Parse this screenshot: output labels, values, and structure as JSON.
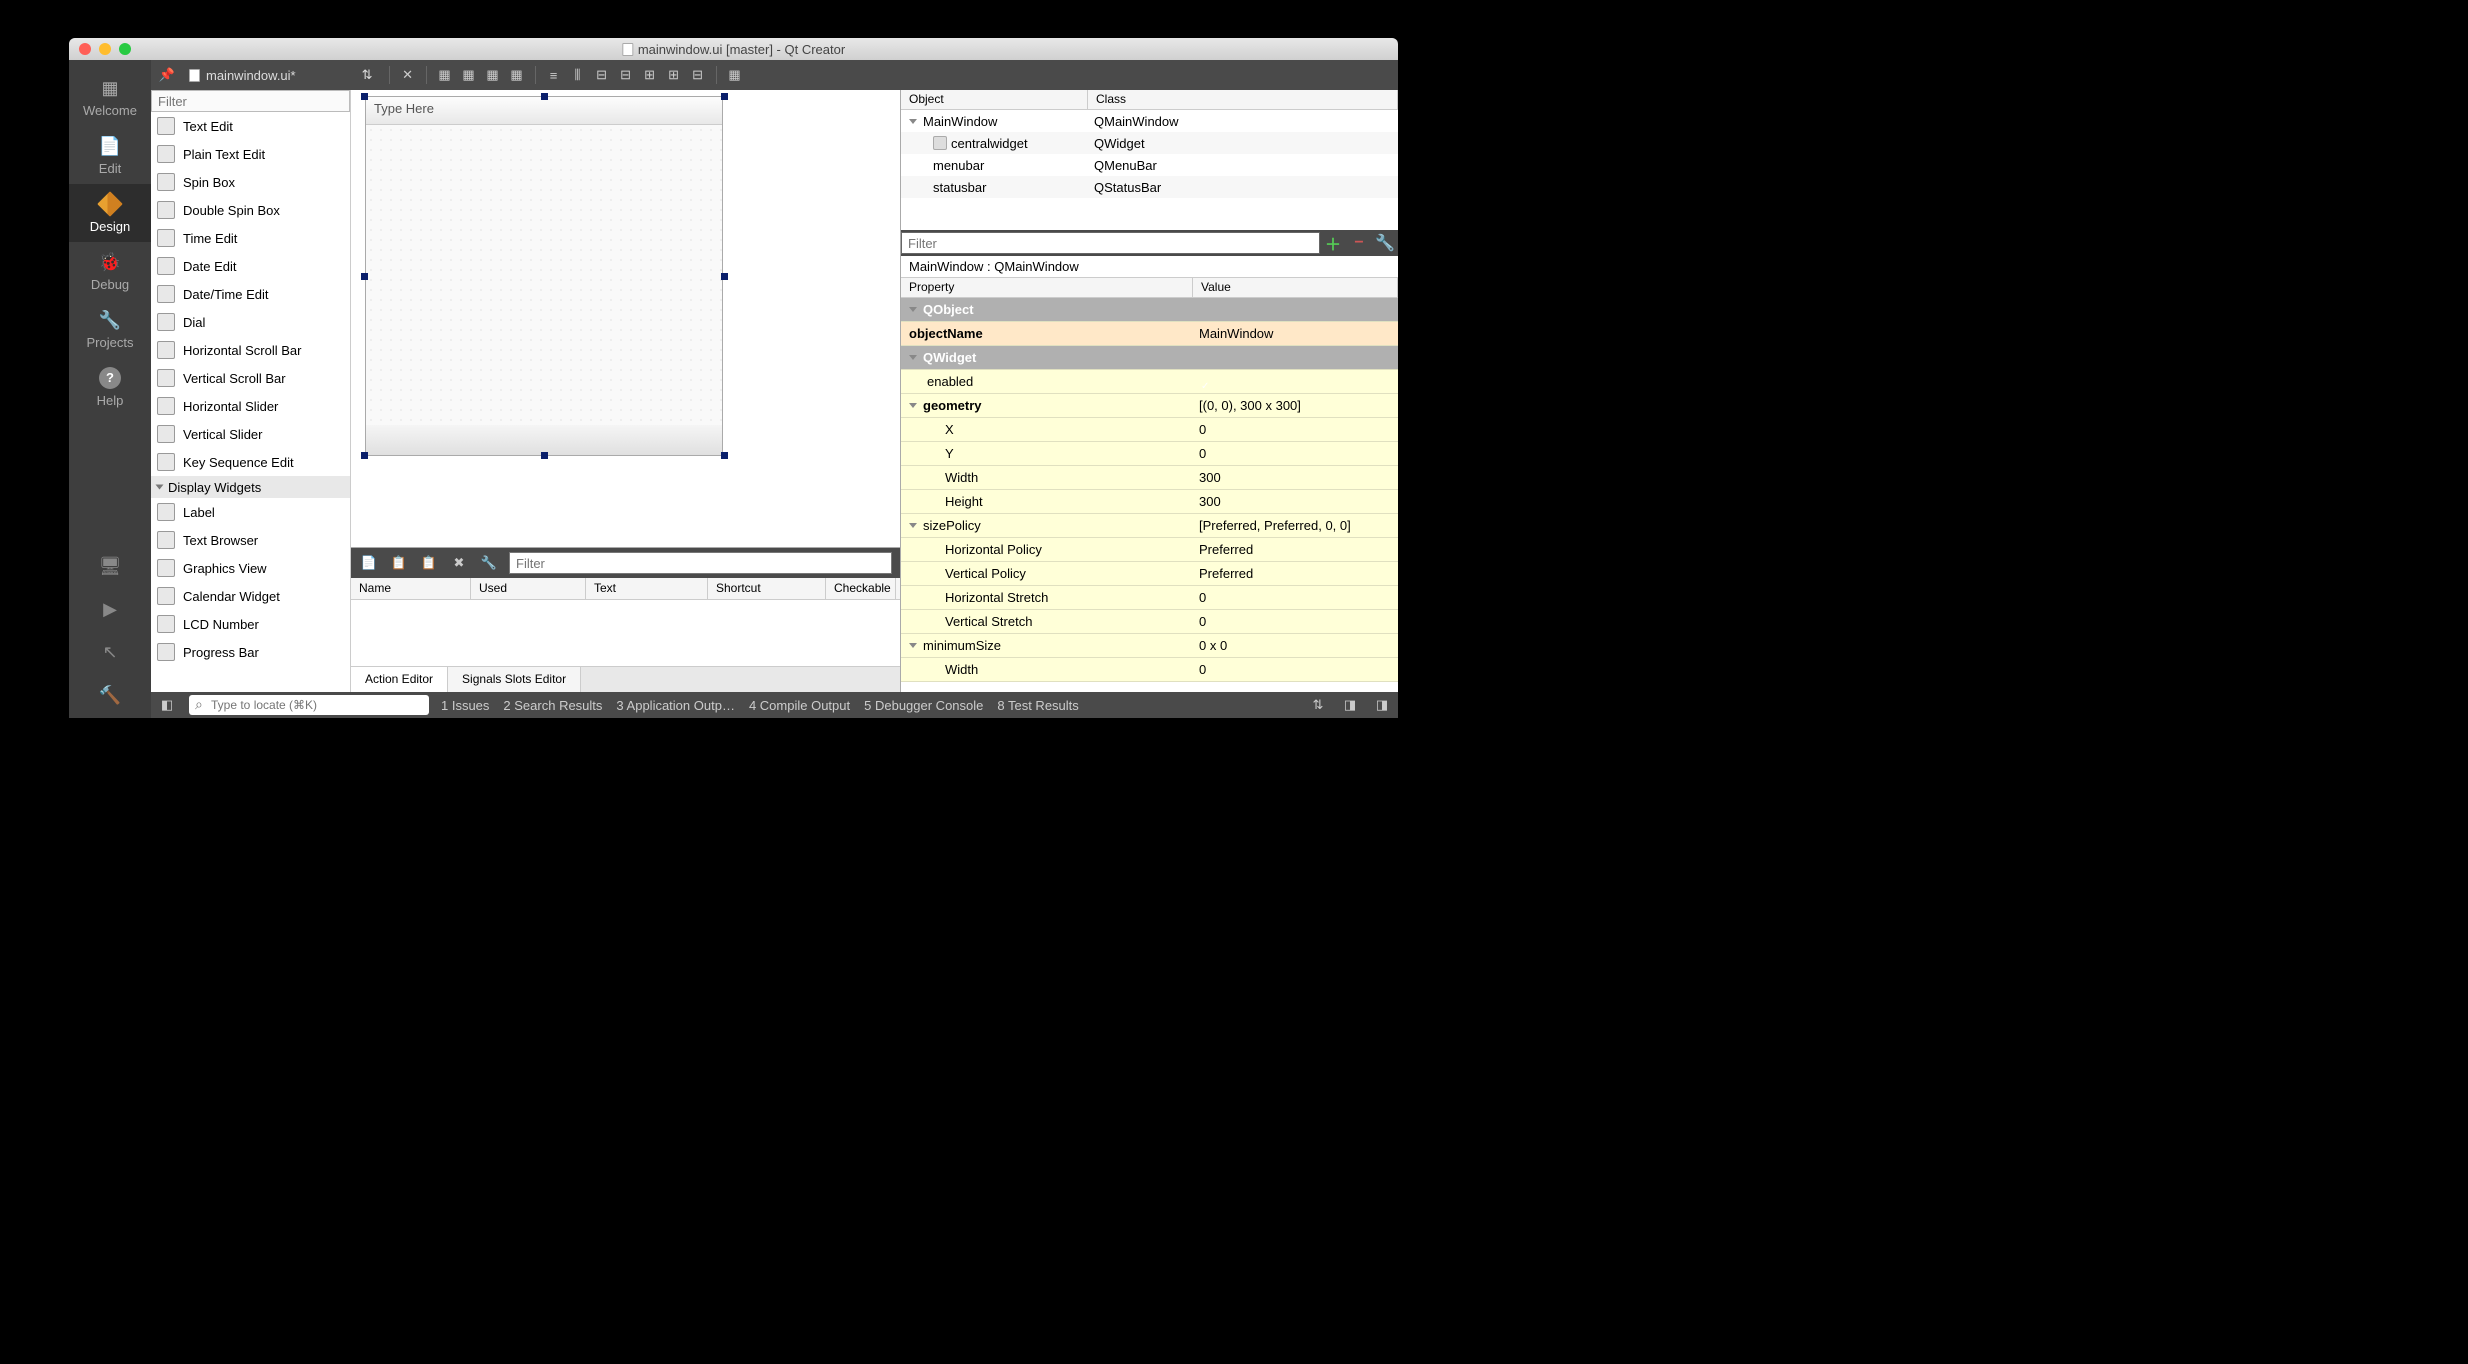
{
  "title": "mainwindow.ui [master] - Qt Creator",
  "toolbar_file": "mainwindow.ui*",
  "sidebar": [
    {
      "label": "Welcome",
      "icon": "grid"
    },
    {
      "label": "Edit",
      "icon": "doc"
    },
    {
      "label": "Design",
      "icon": "pencil",
      "active": true
    },
    {
      "label": "Debug",
      "icon": "bug"
    },
    {
      "label": "Projects",
      "icon": "wrench"
    },
    {
      "label": "Help",
      "icon": "help"
    }
  ],
  "widget_filter_ph": "Filter",
  "widgets": [
    {
      "label": "Text Edit"
    },
    {
      "label": "Plain Text Edit"
    },
    {
      "label": "Spin Box"
    },
    {
      "label": "Double Spin Box"
    },
    {
      "label": "Time Edit"
    },
    {
      "label": "Date Edit"
    },
    {
      "label": "Date/Time Edit"
    },
    {
      "label": "Dial"
    },
    {
      "label": "Horizontal Scroll Bar"
    },
    {
      "label": "Vertical Scroll Bar"
    },
    {
      "label": "Horizontal Slider"
    },
    {
      "label": "Vertical Slider"
    },
    {
      "label": "Key Sequence Edit"
    }
  ],
  "widget_cat": "Display Widgets",
  "widgets2": [
    {
      "label": "Label"
    },
    {
      "label": "Text Browser"
    },
    {
      "label": "Graphics View"
    },
    {
      "label": "Calendar Widget"
    },
    {
      "label": "LCD Number"
    },
    {
      "label": "Progress Bar"
    }
  ],
  "form_menu_ph": "Type Here",
  "action": {
    "filter_ph": "Filter",
    "cols": [
      "Name",
      "Used",
      "Text",
      "Shortcut",
      "Checkable"
    ],
    "tabs": [
      "Action Editor",
      "Signals  Slots Editor"
    ]
  },
  "obj": {
    "cols": [
      "Object",
      "Class"
    ],
    "rows": [
      {
        "o": "MainWindow",
        "c": "QMainWindow",
        "indent": 0,
        "tri": true
      },
      {
        "o": "centralwidget",
        "c": "QWidget",
        "indent": 1,
        "ico": true
      },
      {
        "o": "menubar",
        "c": "QMenuBar",
        "indent": 1
      },
      {
        "o": "statusbar",
        "c": "QStatusBar",
        "indent": 1
      }
    ]
  },
  "prop": {
    "filter_ph": "Filter",
    "label": "MainWindow : QMainWindow",
    "cols": [
      "Property",
      "Value"
    ],
    "rows": [
      {
        "p": "QObject",
        "v": "",
        "cls": "section",
        "tri": true
      },
      {
        "p": "objectName",
        "v": "MainWindow",
        "cls": "hl",
        "bold": true
      },
      {
        "p": "QWidget",
        "v": "",
        "cls": "section",
        "tri": true
      },
      {
        "p": "enabled",
        "v": "",
        "cls": "y",
        "chk": true,
        "indent": 1
      },
      {
        "p": "geometry",
        "v": "[(0, 0), 300 x 300]",
        "cls": "y",
        "tri": true,
        "bold": true
      },
      {
        "p": "X",
        "v": "0",
        "cls": "y",
        "indent": 2
      },
      {
        "p": "Y",
        "v": "0",
        "cls": "y",
        "indent": 2
      },
      {
        "p": "Width",
        "v": "300",
        "cls": "y",
        "indent": 2
      },
      {
        "p": "Height",
        "v": "300",
        "cls": "y",
        "indent": 2
      },
      {
        "p": "sizePolicy",
        "v": "[Preferred, Preferred, 0, 0]",
        "cls": "y",
        "tri": true
      },
      {
        "p": "Horizontal Policy",
        "v": "Preferred",
        "cls": "y",
        "indent": 2
      },
      {
        "p": "Vertical Policy",
        "v": "Preferred",
        "cls": "y",
        "indent": 2
      },
      {
        "p": "Horizontal Stretch",
        "v": "0",
        "cls": "y",
        "indent": 2
      },
      {
        "p": "Vertical Stretch",
        "v": "0",
        "cls": "y",
        "indent": 2
      },
      {
        "p": "minimumSize",
        "v": "0 x 0",
        "cls": "y",
        "tri": true
      },
      {
        "p": "Width",
        "v": "0",
        "cls": "y",
        "indent": 2
      }
    ]
  },
  "status": {
    "locate_ph": "Type to locate (⌘K)",
    "items": [
      "1  Issues",
      "2  Search Results",
      "3  Application Outp…",
      "4  Compile Output",
      "5  Debugger Console",
      "8  Test Results"
    ]
  }
}
